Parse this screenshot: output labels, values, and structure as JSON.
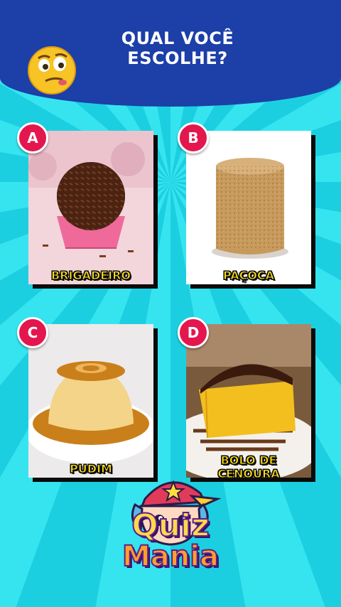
{
  "header": {
    "title_line1": "QUAL VOCÊ",
    "title_line2": "ESCOLHE?",
    "emoji_icon": "thinking-face-emoji-icon"
  },
  "options": [
    {
      "letter": "A",
      "label": "BRIGADEIRO",
      "image": "brigadeiro-image"
    },
    {
      "letter": "B",
      "label": "PAÇOCA",
      "image": "pacoca-image"
    },
    {
      "letter": "C",
      "label": "PUDIM",
      "image": "pudim-image"
    },
    {
      "letter": "D",
      "label_line1": "BOLO DE",
      "label_line2": "CENOURA",
      "image": "bolo-de-cenoura-image"
    }
  ],
  "logo": {
    "line1": "Quiz",
    "line2": "Mania",
    "mascot_icon": "cartoon-kid-mascot-icon"
  },
  "colors": {
    "header_blue": "#1c3fa8",
    "background_cyan": "#1fd6e6",
    "badge_pink": "#e3174e",
    "label_yellow": "#ffe11a"
  }
}
